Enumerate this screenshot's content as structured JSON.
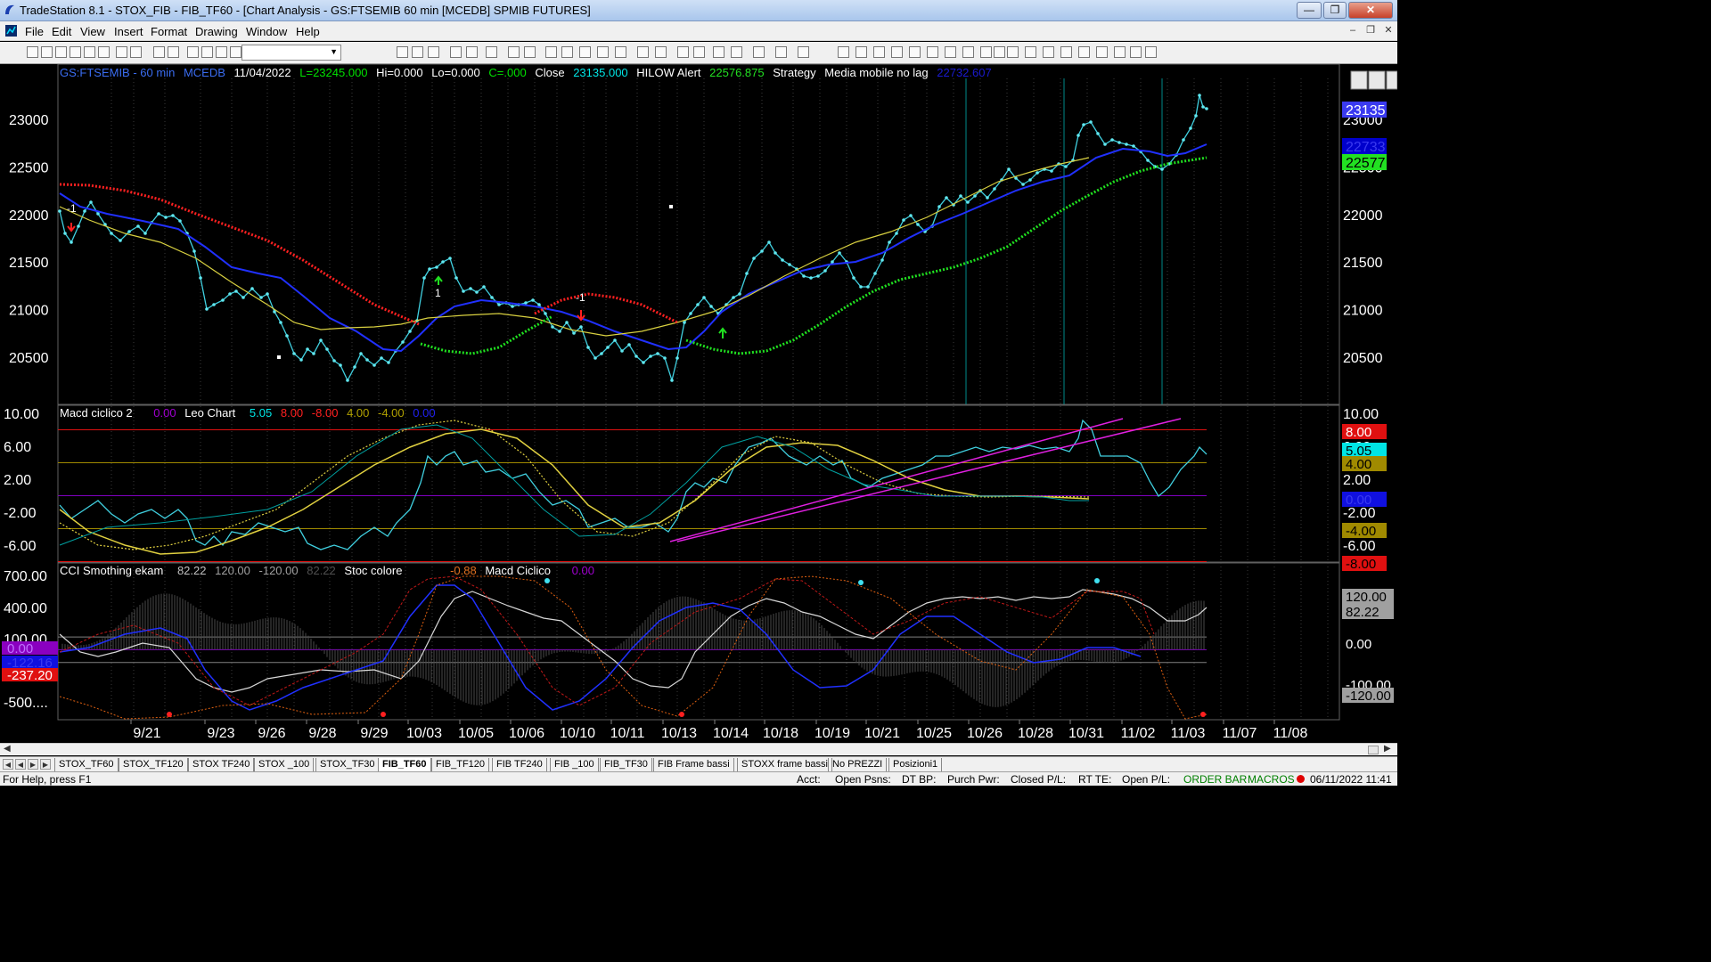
{
  "window": {
    "title": "TradeStation 8.1 - STOX_FIB - FIB_TF60 - [Chart Analysis - GS:FTSEMIB  60 min  [MCEDB] SPMIB FUTURES]",
    "buttons": [
      "minimize",
      "maximize",
      "close"
    ]
  },
  "menu": [
    "File",
    "Edit",
    "View",
    "Insert",
    "Format",
    "Drawing",
    "Window",
    "Help"
  ],
  "price_panel": {
    "legend": {
      "symbol": "GS:FTSEMIB - 60 min",
      "source": "MCEDB",
      "date": "11/04/2022",
      "last": "L=23245.000",
      "hi": "Hi=0.000",
      "lo": "Lo=0.000",
      "change": "C=.000",
      "close_label": "Close",
      "close_value": "23135.000",
      "hilow_label": "HILOW Alert",
      "hilow_value": "22576.875",
      "strategy_label": "Strategy",
      "ma_label": "Media mobile no lag",
      "ma_value": "22732.607"
    },
    "y_ticks": [
      "23000",
      "22500",
      "22000",
      "21500",
      "21000",
      "20500"
    ],
    "right_ticks": [
      "23000",
      "22500",
      "22000",
      "21500",
      "21000",
      "20500"
    ],
    "price_boxes": [
      {
        "label": "23135",
        "bg": "#3a3af0",
        "fg": "#ffffff"
      },
      {
        "label": "22733",
        "bg": "#0000cc",
        "fg": "#3a3af0"
      },
      {
        "label": "22577",
        "bg": "#22e022",
        "fg": "#000000"
      }
    ],
    "markers": [
      {
        "text": "-1",
        "color": "#ffffff"
      },
      {
        "text": "1",
        "color": "#ffffff"
      },
      {
        "text": "-1",
        "color": "#ffffff"
      }
    ]
  },
  "macd_panel": {
    "legend": {
      "name": "Macd ciclico 2",
      "v1": "0.00",
      "leo": "Leo Chart",
      "v2": "5.05",
      "v3": "8.00",
      "v4": "-8.00",
      "v5": "4.00",
      "v6": "-4.00",
      "v7": "0.00"
    },
    "y_ticks": [
      "10.00",
      "6.00",
      "2.00",
      "-2.00",
      "-6.00"
    ],
    "right_ticks": [
      "10.00",
      "6.00",
      "2.00",
      "-2.00",
      "-6.00"
    ],
    "boxes": [
      {
        "label": "8.00",
        "bg": "#e01010",
        "fg": "#ffffff"
      },
      {
        "label": "5.05",
        "bg": "#00e5e5",
        "fg": "#000000"
      },
      {
        "label": "4.00",
        "bg": "#a08a00",
        "fg": "#000000"
      },
      {
        "label": "0.00",
        "bg": "#1010e0",
        "fg": "#3a3af0"
      },
      {
        "label": "-4.00",
        "bg": "#a08a00",
        "fg": "#000000"
      },
      {
        "label": "-8.00",
        "bg": "#e01010",
        "fg": "#000000"
      }
    ]
  },
  "cci_panel": {
    "legend": {
      "name": "CCI Smothing ekam",
      "v1": "82.22",
      "v2": "120.00",
      "v3": "-120.00",
      "v4": "82.22",
      "stoc": "Stoc colore",
      "v5": "-0.88",
      "macd": "Macd Ciclico",
      "v6": "0.00"
    },
    "y_ticks": [
      "700.00",
      "400.00",
      "100.00",
      "-500...."
    ],
    "left_boxes": [
      {
        "label": "0.00",
        "bg": "#8a00c0",
        "fg": "#c070ff"
      },
      {
        "label": "-122.16",
        "bg": "#1010e0",
        "fg": "#3a3af0"
      },
      {
        "label": "-237.20",
        "bg": "#e01010",
        "fg": "#ffffff"
      }
    ],
    "right_boxes": [
      {
        "label": "120.00",
        "bg": "#a0a0a0",
        "fg": "#000000"
      },
      {
        "label": "82.22",
        "bg": "#a0a0a0",
        "fg": "#000000"
      },
      {
        "label": "0.00",
        "bg": "#000000",
        "fg": "#ffffff"
      },
      {
        "label": "-100.00",
        "bg": "#000000",
        "fg": "#ffffff"
      },
      {
        "label": "-120.00",
        "bg": "#a0a0a0",
        "fg": "#000000"
      }
    ]
  },
  "x_axis": [
    "9/21",
    "9/23",
    "9/26",
    "9/28",
    "9/29",
    "10/03",
    "10/05",
    "10/06",
    "10/10",
    "10/11",
    "10/13",
    "10/14",
    "10/18",
    "10/19",
    "10/21",
    "10/25",
    "10/26",
    "10/28",
    "10/31",
    "11/02",
    "11/03",
    "11/07",
    "11/08"
  ],
  "tabs": [
    "STOX_TF60",
    "STOX_TF120",
    "STOX TF240",
    "STOX _100",
    "STOX_TF30",
    "FIB_TF60",
    "FIB_TF120",
    "FIB TF240",
    "FIB _100",
    "FIB_TF30",
    "FIB Frame bassi",
    "STOXX frame bassi",
    "No PREZZI",
    "Posizioni1"
  ],
  "active_tab": "FIB_TF60",
  "status": {
    "help": "For Help, press F1",
    "acct": "Acct:",
    "open_psns": "Open Psns:",
    "dt_bp": "DT BP:",
    "purch_pwr": "Purch Pwr:",
    "closed_pl": "Closed P/L:",
    "rt_te": "RT TE:",
    "open_pl": "Open P/L:",
    "order_bar": "ORDER BAR",
    "macros": "MACROS",
    "datetime": "06/11/2022 11:41"
  }
}
